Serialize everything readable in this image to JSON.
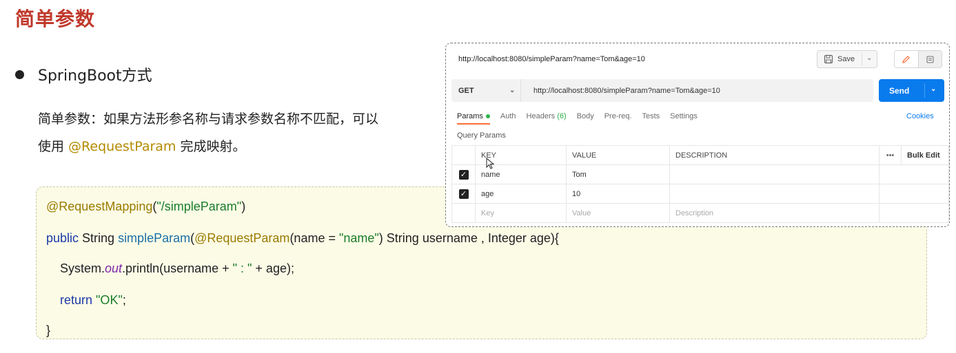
{
  "slide": {
    "title": "简单参数",
    "bullet": "SpringBoot方式",
    "desc_line1": "简单参数：如果方法形参名称与请求参数名称不匹配，可以",
    "desc_line2_pre": "使用 ",
    "desc_line2_hl": "@RequestParam",
    "desc_line2_post": " 完成映射。"
  },
  "code": {
    "l1_ann": "@RequestMapping",
    "l1_p1": "(",
    "l1_str": "\"/simpleParam\"",
    "l1_p2": ")",
    "l2_kw": "public",
    "l2_t1": " String ",
    "l2_fn": "simpleParam",
    "l2_p1": "(",
    "l2_ann": "@RequestParam",
    "l2_t2": "(name = ",
    "l2_str": "\"name\"",
    "l2_t3": ") String username , Integer age){",
    "l3_t1": "System.",
    "l3_it": "out",
    "l3_t2": ".println(username + ",
    "l3_str": "\" : \"",
    "l3_t3": " + age);",
    "l4_kw": "return",
    "l4_sp": " ",
    "l4_str": "\"OK\"",
    "l4_t": ";",
    "l5": "}"
  },
  "postman": {
    "title": "http://localhost:8080/simpleParam?name=Tom&age=10",
    "save_label": "Save",
    "method": "GET",
    "url": "http://localhost:8080/simpleParam?name=Tom&age=10",
    "send_label": "Send",
    "tabs": {
      "params": "Params",
      "auth": "Auth",
      "headers": "Headers",
      "headers_count": "(6)",
      "body": "Body",
      "prereq": "Pre-req.",
      "tests": "Tests",
      "settings": "Settings"
    },
    "cookies": "Cookies",
    "query_params_label": "Query Params",
    "columns": {
      "key": "KEY",
      "value": "VALUE",
      "description": "DESCRIPTION",
      "more": "•••",
      "bulk_edit": "Bulk Edit"
    },
    "rows": [
      {
        "checked": true,
        "key": "name",
        "value": "Tom",
        "description": ""
      },
      {
        "checked": true,
        "key": "age",
        "value": "10",
        "description": ""
      }
    ],
    "placeholders": {
      "key": "Key",
      "value": "Value",
      "description": "Description"
    }
  },
  "colors": {
    "title": "#c0392b",
    "send": "#097bed",
    "tab_indicator": "#ff6c37",
    "green": "#2db34a"
  }
}
